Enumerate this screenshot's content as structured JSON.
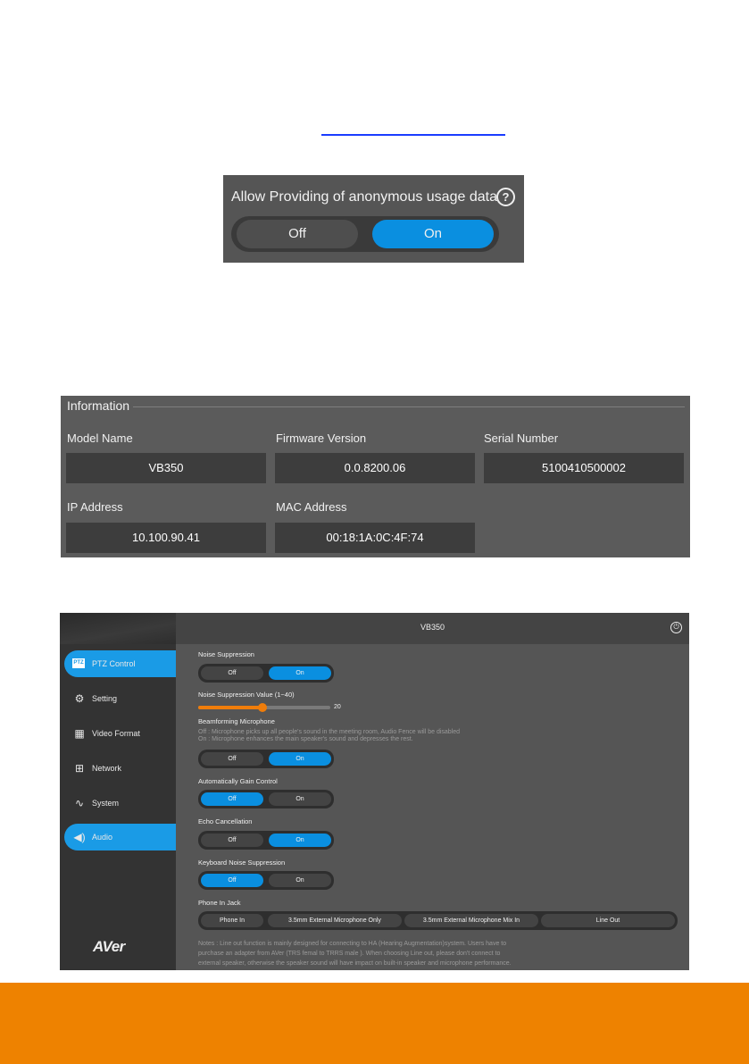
{
  "usage": {
    "title": "Allow Providing of anonymous usage data",
    "help": "?",
    "off_label": "Off",
    "on_label": "On",
    "selected": "On"
  },
  "info": {
    "title": "Information",
    "fields": [
      {
        "label": "Model Name",
        "value": "VB350"
      },
      {
        "label": "Firmware Version",
        "value": "0.0.8200.06"
      },
      {
        "label": "Serial Number",
        "value": "5100410500002"
      },
      {
        "label": "IP Address",
        "value": "10.100.90.41"
      },
      {
        "label": "MAC Address",
        "value": "00:18:1A:0C:4F:74"
      }
    ]
  },
  "app": {
    "title": "VB350",
    "sidebar": [
      {
        "label": "PTZ Control",
        "icon": "ptz-icon",
        "badge": "PTZ"
      },
      {
        "label": "Setting",
        "icon": "gear-icon"
      },
      {
        "label": "Video Format",
        "icon": "film-icon"
      },
      {
        "label": "Network",
        "icon": "network-icon"
      },
      {
        "label": "System",
        "icon": "pulse-icon"
      },
      {
        "label": "Audio",
        "icon": "speaker-icon"
      }
    ],
    "logo": "AVer",
    "audio": {
      "noise_suppression": {
        "label": "Noise Suppression",
        "off": "Off",
        "on": "On",
        "selected": "On"
      },
      "noise_suppression_value": {
        "label": "Noise Suppression Value (1~40)",
        "value": 20,
        "min": 1,
        "max": 40,
        "display": "20"
      },
      "beamforming": {
        "label": "Beamforming Microphone",
        "desc_off": "Off : Microphone picks up all people's sound in the meeting room, Audio Fence will be disabled",
        "desc_on": "On : Microphone enhances the main speaker's sound and depresses the rest.",
        "off": "Off",
        "on": "On",
        "selected": "On"
      },
      "agc": {
        "label": "Automatically Gain Control",
        "off": "Off",
        "on": "On",
        "selected": "Off"
      },
      "echo": {
        "label": "Echo Cancellation",
        "off": "Off",
        "on": "On",
        "selected": "On"
      },
      "keyboard": {
        "label": "Keyboard Noise Suppression",
        "off": "Off",
        "on": "On",
        "selected": "Off"
      },
      "phone_jack": {
        "label": "Phone In Jack",
        "options": [
          "Phone In",
          "3.5mm External Microphone Only",
          "3.5mm External Microphone Mix In",
          "Line Out"
        ],
        "selected": "Phone In"
      },
      "notes": [
        "Notes : Line out function is mainly designed for connecting to HA (Hearing Augmentation)system. Users have to",
        "purchase an adapter from AVer (TRS femal to TRRS male ). When choosing Line out, please don't connect to",
        "external speaker, otherwise the speaker sound will have impact on built-in speaker and microphone performance."
      ]
    }
  },
  "colors": {
    "accent": "#0a8fe0",
    "slider": "#f07d0a",
    "footer": "#ee8200",
    "link": "#1a3cff"
  }
}
